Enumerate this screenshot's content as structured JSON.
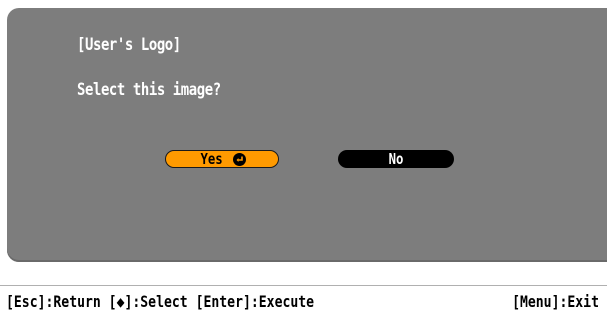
{
  "dialog": {
    "title": "[User's Logo]",
    "message": "Select this image?",
    "yes_label": "Yes",
    "no_label": "No",
    "yes_icon": "enter-key-icon"
  },
  "help_bar": {
    "left_text": "[Esc]:Return [◆]:Select [Enter]:Execute",
    "right_text": "[Menu]:Exit"
  },
  "colors": {
    "dialog_bg": "#7d7d7d",
    "selected_button": "#ff9a00",
    "unselected_button": "#000000",
    "text": "#ffffff"
  }
}
